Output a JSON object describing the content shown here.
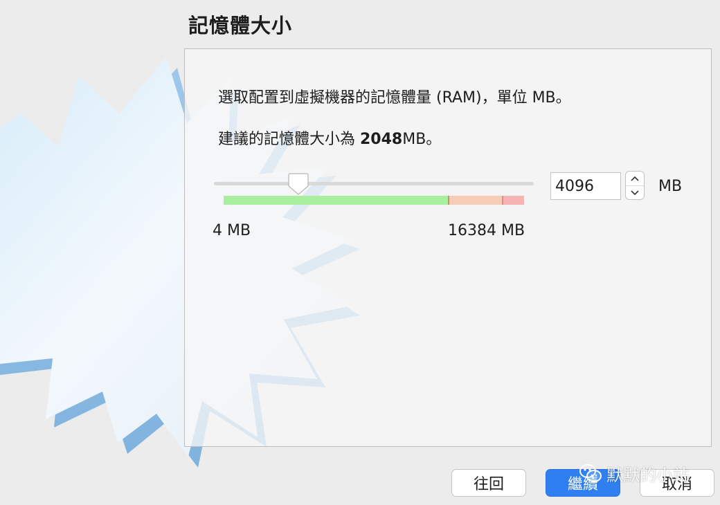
{
  "header": {
    "title": "記憶體大小"
  },
  "panel": {
    "description": "選取配置到虛擬機器的記憶體量 (RAM)，單位 MB。",
    "recommended_prefix": "建議的記憶體大小為 ",
    "recommended_value": "2048",
    "recommended_suffix": "MB。",
    "slider": {
      "min_label": "4 MB",
      "max_label": "16384 MB",
      "min": 4,
      "max": 16384,
      "value": 4096
    },
    "memory_input": {
      "value": "4096"
    },
    "unit": "MB"
  },
  "footer": {
    "back_label": "往回",
    "continue_label": "繼續",
    "cancel_label": "取消"
  },
  "watermark": {
    "text": "默默的小站"
  },
  "colors": {
    "accent": "#2f7ff0",
    "range_green": "#a8f0a0",
    "range_orange": "#f8cdb8",
    "range_red": "#f6b3b3"
  },
  "icons": {
    "stepper_up": "chevron-up-icon",
    "stepper_down": "chevron-down-icon",
    "watermark_logo": "wechat-icon"
  }
}
